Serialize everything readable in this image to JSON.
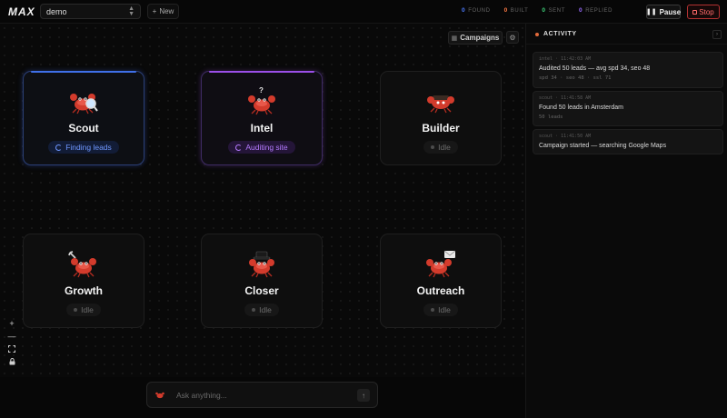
{
  "app": {
    "logo": "MAX"
  },
  "campaign_select": {
    "value": "demo"
  },
  "new_button": {
    "label": "New"
  },
  "stats": [
    {
      "count": "0",
      "label": "FOUND",
      "color": "#4d7cff"
    },
    {
      "count": "0",
      "label": "BUILT",
      "color": "#ff7a45"
    },
    {
      "count": "0",
      "label": "SENT",
      "color": "#3fd17a"
    },
    {
      "count": "0",
      "label": "REPLIED",
      "color": "#9a6bff"
    }
  ],
  "controls": {
    "pause": "Pause",
    "stop": "Stop"
  },
  "canvas": {
    "campaigns_label": "Campaigns"
  },
  "agents": [
    {
      "name": "Scout",
      "status": "Finding leads",
      "state": "active",
      "accent": "#3f70e8",
      "icon": "magnifier-crab-icon"
    },
    {
      "name": "Intel",
      "status": "Auditing site",
      "state": "active",
      "accent": "#9b4fe8",
      "icon": "question-crab-icon"
    },
    {
      "name": "Builder",
      "status": "Idle",
      "state": "idle",
      "accent": "#6c6c6c",
      "icon": "builder-crab-icon"
    },
    {
      "name": "Growth",
      "status": "Idle",
      "state": "idle",
      "accent": "#6c6c6c",
      "icon": "wrench-crab-icon"
    },
    {
      "name": "Closer",
      "status": "Idle",
      "state": "idle",
      "accent": "#6c6c6c",
      "icon": "hat-crab-icon"
    },
    {
      "name": "Outreach",
      "status": "Idle",
      "state": "idle",
      "accent": "#6c6c6c",
      "icon": "mail-crab-icon"
    }
  ],
  "zoom_controls": {
    "zoom_in": "+",
    "zoom_out": "—"
  },
  "chat": {
    "placeholder": "Ask anything..."
  },
  "activity": {
    "title": "ACTIVITY",
    "items": [
      {
        "meta": "intel · 11:42:03 AM",
        "text": "Audited 50 leads — avg spd 34, seo 48",
        "sub": "spd 34 · seo 48 · ssl 71"
      },
      {
        "meta": "scout · 11:41:58 AM",
        "text": "Found 50 leads in Amsterdam",
        "sub": "50 leads"
      },
      {
        "meta": "scout · 11:41:50 AM",
        "text": "Campaign started — searching Google Maps",
        "sub": ""
      }
    ]
  }
}
